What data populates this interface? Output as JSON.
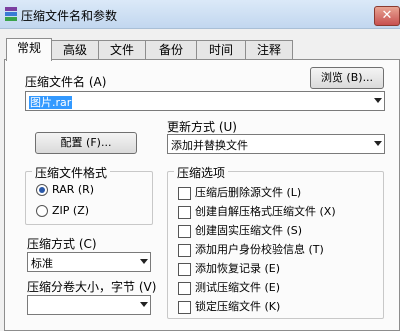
{
  "window": {
    "title": "压缩文件名和参数",
    "close_glyph": "✕"
  },
  "tabs": [
    {
      "label": "常规",
      "active": true
    },
    {
      "label": "高级"
    },
    {
      "label": "文件"
    },
    {
      "label": "备份"
    },
    {
      "label": "时间"
    },
    {
      "label": "注释"
    }
  ],
  "archive_name": {
    "label": "压缩文件名 (A)",
    "value": "图片.rar",
    "browse_label": "浏览 (B)..."
  },
  "update_mode": {
    "label": "更新方式 (U)",
    "value": "添加并替换文件"
  },
  "config_button": "配置 (F)...",
  "format": {
    "title": "压缩文件格式",
    "options": [
      {
        "label": "RAR (R)",
        "checked": true
      },
      {
        "label": "ZIP (Z)",
        "checked": false
      }
    ]
  },
  "method": {
    "label": "压缩方式 (C)",
    "value": "标准"
  },
  "split": {
    "label": "压缩分卷大小，字节 (V)",
    "value": ""
  },
  "options": {
    "title": "压缩选项",
    "items": [
      "压缩后删除源文件 (L)",
      "创建自解压格式压缩文件 (X)",
      "创建固实压缩文件 (S)",
      "添加用户身份校验信息 (T)",
      "添加恢复记录 (E)",
      "测试压缩文件 (E)",
      "锁定压缩文件 (K)"
    ]
  }
}
